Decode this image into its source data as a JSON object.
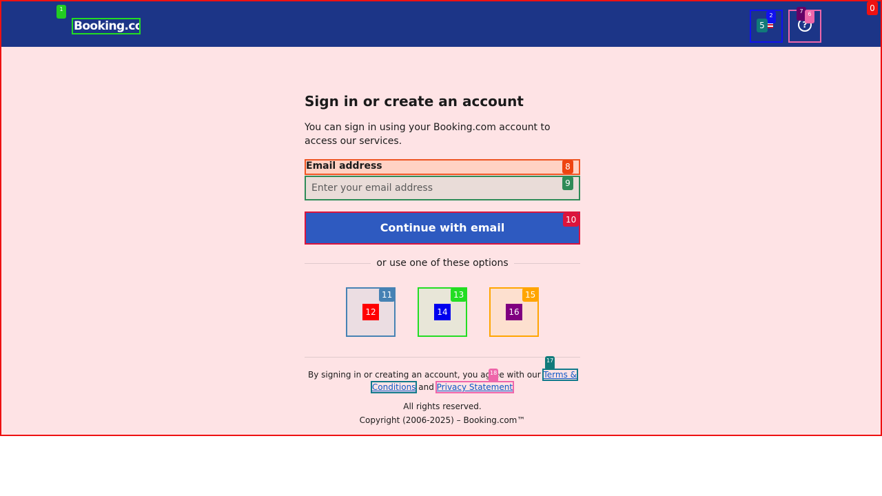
{
  "header": {
    "logo": "Booking.com",
    "language_flag_icon": "uk-flag-icon",
    "help_icon": "question-icon"
  },
  "signin": {
    "title": "Sign in or create an account",
    "description": "You can sign in using your Booking.com account to access our services.",
    "email_label": "Email address",
    "email_placeholder": "Enter your email address",
    "continue_button": "Continue with email",
    "divider_text": "or use one of these options",
    "social": [
      {
        "name": "google",
        "icon": "google-icon"
      },
      {
        "name": "apple",
        "icon": "apple-icon"
      },
      {
        "name": "facebook",
        "icon": "facebook-icon"
      }
    ]
  },
  "footer": {
    "legal_prefix": "By signing in or creating an account, you agree with our",
    "terms_link": "Terms & Conditions",
    "and_text": "and",
    "privacy_link": "Privacy Statement",
    "rights": "All rights reserved.",
    "copyright": "Copyright (2006-2025) – Booking.com™"
  },
  "overlay_tags": {
    "t0": "0",
    "t1": "1",
    "t2": "2",
    "t3": "3",
    "t4": "4",
    "t5": "5",
    "t6": "6",
    "t7": "7",
    "t8": "8",
    "t9": "9",
    "t10": "10",
    "t11": "11",
    "t12": "12",
    "t13": "13",
    "t14": "14",
    "t15": "15",
    "t16": "16",
    "t17": "17",
    "t18": "18"
  },
  "colors": {
    "header_bg": "#1c3587",
    "page_bg": "#fee3e5",
    "cta_bg": "#2e5ac0",
    "link": "#0b57c7"
  }
}
